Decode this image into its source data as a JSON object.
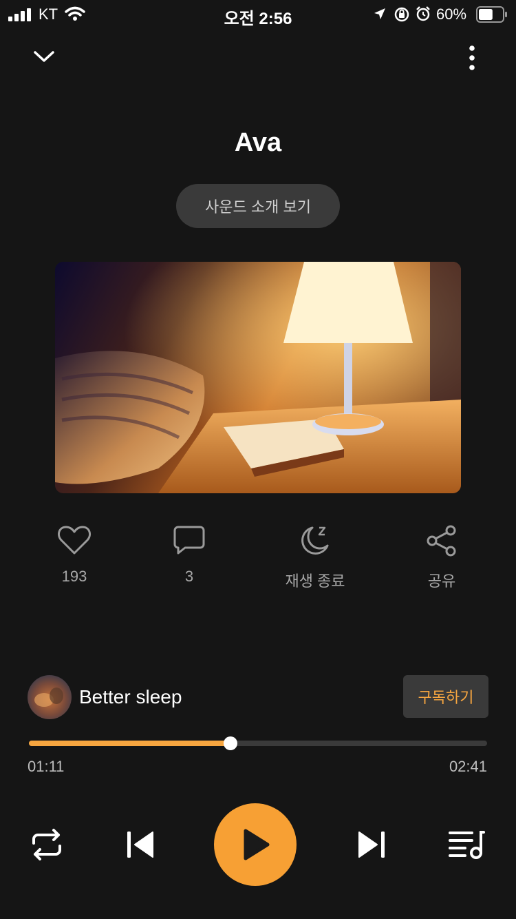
{
  "status_bar": {
    "carrier": "KT",
    "time": "오전 2:56",
    "battery_percent": "60%",
    "battery_level": 0.6
  },
  "header": {
    "collapse_icon": "chevron-down-icon",
    "more_icon": "more-vertical-icon"
  },
  "track": {
    "title": "Ava",
    "intro_button_label": "사운드 소개 보기"
  },
  "actions": {
    "like_count": "193",
    "comment_count": "3",
    "sleep_timer_label": "재생 종료",
    "share_label": "공유"
  },
  "channel": {
    "name": "Better sleep",
    "subscribe_label": "구독하기"
  },
  "playback": {
    "current_time": "01:11",
    "total_time": "02:41",
    "progress": 0.44
  },
  "colors": {
    "accent": "#f7a640",
    "background": "#151515"
  }
}
